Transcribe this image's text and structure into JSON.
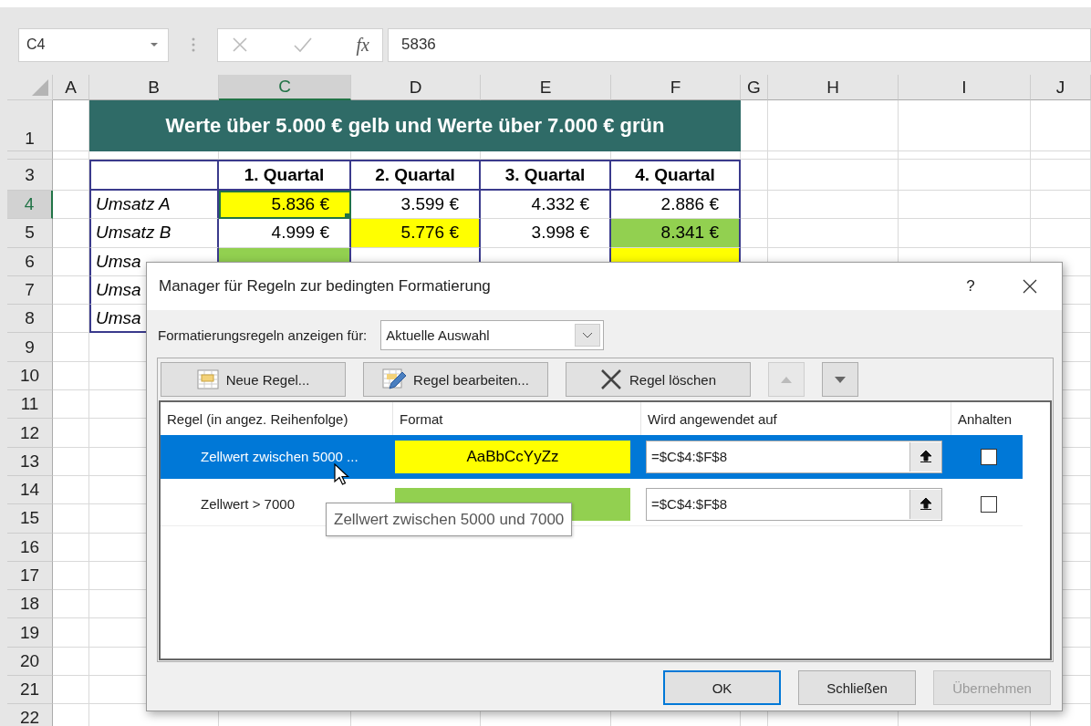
{
  "formula_bar": {
    "name_box": "C4",
    "function_label": "fx",
    "formula": "5836"
  },
  "columns": [
    {
      "label": "A",
      "selected": false
    },
    {
      "label": "B",
      "selected": false
    },
    {
      "label": "C",
      "selected": true
    },
    {
      "label": "D",
      "selected": false
    },
    {
      "label": "E",
      "selected": false
    },
    {
      "label": "F",
      "selected": false
    },
    {
      "label": "G",
      "selected": false
    },
    {
      "label": "H",
      "selected": false
    },
    {
      "label": "I",
      "selected": false
    },
    {
      "label": "J",
      "selected": false
    }
  ],
  "rows": [
    {
      "label": "1",
      "selected": false
    },
    {
      "selected": false
    },
    {
      "label": "3",
      "selected": false
    },
    {
      "label": "4",
      "selected": true
    },
    {
      "label": "5",
      "selected": false
    },
    {
      "label": "6",
      "selected": false
    },
    {
      "label": "7",
      "selected": false
    },
    {
      "label": "8",
      "selected": false
    },
    {
      "label": "9",
      "selected": false
    },
    {
      "label": "10",
      "selected": false
    },
    {
      "label": "11",
      "selected": false
    },
    {
      "label": "12",
      "selected": false
    },
    {
      "label": "13",
      "selected": false
    },
    {
      "label": "14",
      "selected": false
    },
    {
      "label": "15",
      "selected": false
    },
    {
      "label": "16",
      "selected": false
    },
    {
      "label": "17",
      "selected": false
    },
    {
      "label": "18",
      "selected": false
    },
    {
      "label": "19",
      "selected": false
    },
    {
      "label": "20",
      "selected": false
    },
    {
      "label": "21",
      "selected": false
    },
    {
      "label": "22",
      "selected": false
    }
  ],
  "banner": "Werte über 5.000 € gelb und Werte über 7.000 € grün",
  "table": {
    "columns": [
      "1. Quartal",
      "2. Quartal",
      "3. Quartal",
      "4. Quartal"
    ],
    "rows": [
      {
        "label": "Umsatz A",
        "cells": [
          {
            "value": "5.836 €",
            "color": "#ffff00",
            "selected": true
          },
          {
            "value": "3.599 €",
            "selected": false
          },
          {
            "value": "4.332 €",
            "selected": false
          },
          {
            "value": "2.886 €",
            "selected": false
          }
        ]
      },
      {
        "label": "Umsatz B",
        "cells": [
          {
            "value": "4.999 €",
            "selected": false
          },
          {
            "value": "5.776 €",
            "color": "#ffff00",
            "selected": false
          },
          {
            "value": "3.998 €",
            "selected": false
          },
          {
            "value": "8.341 €",
            "color": "#92d050",
            "selected": false
          }
        ]
      },
      {
        "label": "Umsa",
        "cells": [
          {
            "color": "#92d050",
            "selected": false
          },
          {
            "selected": false
          },
          {
            "selected": false
          },
          {
            "color": "#ffff00",
            "selected": false
          }
        ]
      },
      {
        "label": "Umsa",
        "cells": []
      },
      {
        "label": "Umsa",
        "cells": []
      }
    ]
  },
  "dialog": {
    "title": "Manager für Regeln zur bedingten Formatierung",
    "help": "?",
    "scope_label": "Formatierungsregeln anzeigen für:",
    "scope": "Aktuelle Auswahl",
    "toolbar": [
      {
        "kind": "new",
        "label": "Neue Regel...",
        "disabled": false
      },
      {
        "kind": "edit",
        "label": "Regel bearbeiten...",
        "disabled": false
      },
      {
        "kind": "delete",
        "label": "Regel löschen",
        "disabled": false
      },
      {
        "kind": "up",
        "disabled": true
      },
      {
        "kind": "down",
        "disabled": false
      }
    ],
    "rule_columns": [
      "Regel (in angez. Reihenfolge)",
      "Format",
      "Wird angewendet auf",
      "Anhalten"
    ],
    "rules": [
      {
        "name": "Zellwert zwischen 5000 ...",
        "preview": "AaBbCcYyZz",
        "color": "#ffff00",
        "applies_to": "=$C$4:$F$8",
        "stop": false,
        "selected": true
      },
      {
        "name": "Zellwert > 7000",
        "color": "#92d050",
        "applies_to": "=$C$4:$F$8",
        "stop": false,
        "selected": false
      }
    ],
    "tooltip": "Zellwert zwischen 5000 und 7000",
    "buttons": [
      {
        "label": "OK",
        "default": true,
        "disabled": false
      },
      {
        "label": "Schließen",
        "default": false,
        "disabled": false
      },
      {
        "label": "Übernehmen",
        "default": false,
        "disabled": true
      }
    ]
  }
}
